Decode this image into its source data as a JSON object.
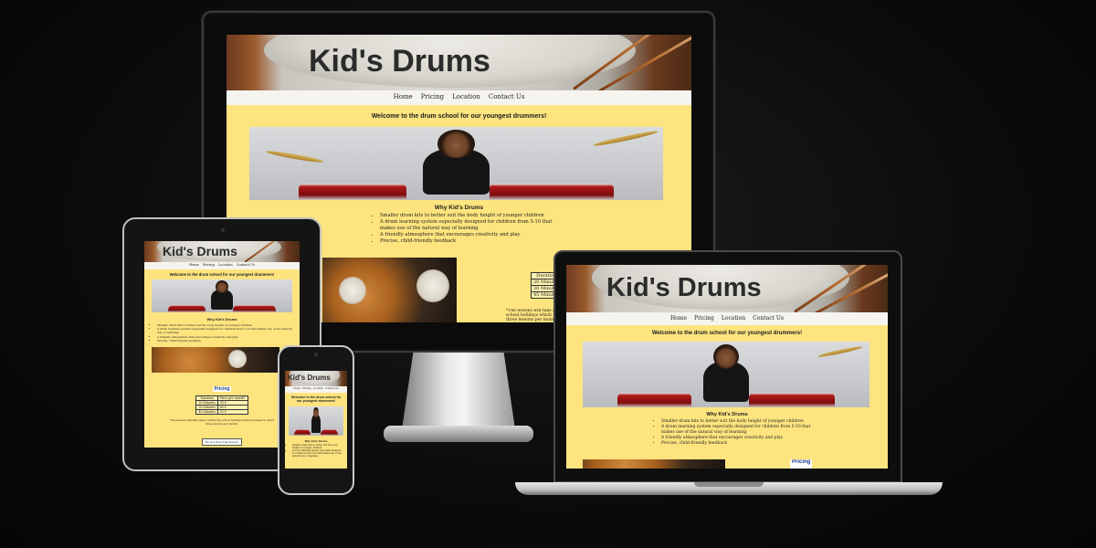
{
  "site": {
    "title": "Kid's Drums",
    "nav": [
      "Home",
      "Pricing",
      "Location",
      "Contact Us"
    ],
    "welcome": "Welcome to the drum school for our youngest drummers!",
    "why_title": "Why Kid's Drums",
    "why_items": [
      "Smaller drum kits to better suit the body height of younger children",
      "A drum learning system especially designed for children from 5-10 that makes use of the natural way of learning",
      "A friendly atmosphere that encourages creativity and play",
      "Precise, child-friendly feedback"
    ],
    "pricing_title": "Pricing",
    "pricing_headers": [
      "Duration",
      "Price per month*"
    ],
    "pricing_rows": [
      [
        "20 Minutes",
        "30 €"
      ],
      [
        "30 Minutes",
        "40 €"
      ],
      [
        "45 Minutes",
        "55 €"
      ]
    ],
    "pricing_note": "*The lessons will take place outside the school holidays which averages to about three lessons per month.",
    "trial_button": "Book a free trial lesson!"
  },
  "colors": {
    "page_bg": "#fde47f",
    "nav_bg": "#f6f4ef",
    "pricing_heading": "#1b3a8a"
  }
}
